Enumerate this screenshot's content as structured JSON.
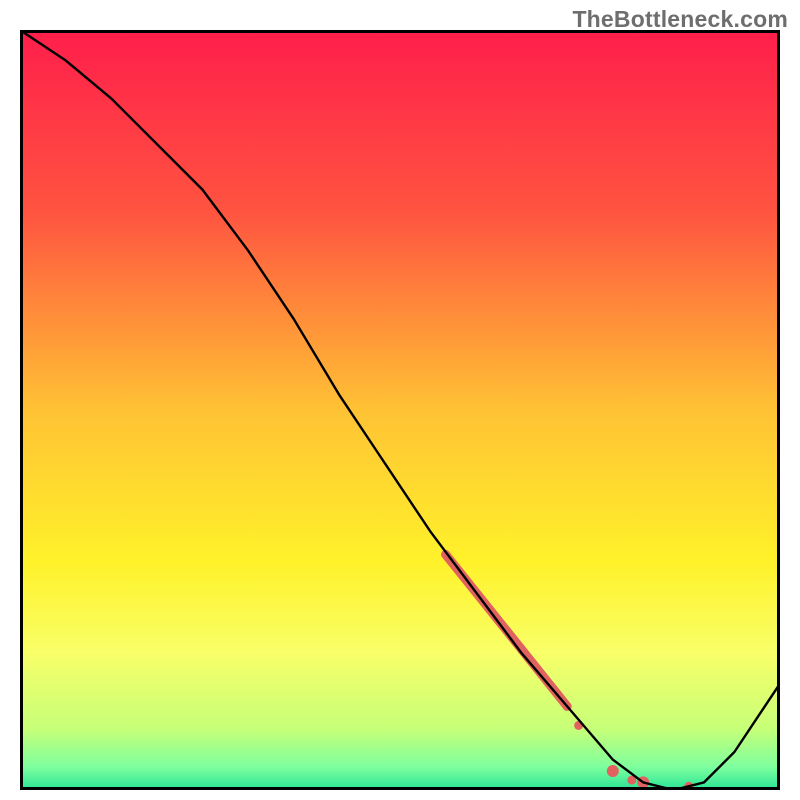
{
  "watermark": "TheBottleneck.com",
  "chart_data": {
    "type": "line",
    "title": "",
    "xlabel": "",
    "ylabel": "",
    "xlim": [
      0,
      100
    ],
    "ylim": [
      0,
      100
    ],
    "background_gradient": {
      "stops": [
        {
          "offset": 0.0,
          "color": "#ff1e4b"
        },
        {
          "offset": 0.24,
          "color": "#ff5440"
        },
        {
          "offset": 0.5,
          "color": "#ffc234"
        },
        {
          "offset": 0.7,
          "color": "#fff22a"
        },
        {
          "offset": 0.82,
          "color": "#f8ff68"
        },
        {
          "offset": 0.92,
          "color": "#c6ff78"
        },
        {
          "offset": 0.97,
          "color": "#7dff9e"
        },
        {
          "offset": 1.0,
          "color": "#28e396"
        }
      ]
    },
    "series": [
      {
        "name": "curve",
        "x": [
          0,
          6,
          12,
          18,
          24,
          30,
          36,
          42,
          48,
          54,
          60,
          66,
          72,
          78,
          82,
          86,
          90,
          94,
          100
        ],
        "y": [
          100,
          96,
          91,
          85,
          79,
          71,
          62,
          52,
          43,
          34,
          26,
          18,
          11,
          4,
          1,
          0,
          1,
          5,
          14
        ]
      }
    ],
    "highlight_segments": [
      {
        "name": "thick-segment",
        "x": [
          56,
          72
        ],
        "y": [
          31,
          11
        ],
        "width": 9,
        "color": "#e1625f"
      }
    ],
    "highlight_points": [
      {
        "x": 73.5,
        "y": 8.5,
        "r": 4.5,
        "color": "#e1625f"
      },
      {
        "x": 80.5,
        "y": 1.3,
        "r": 4.5,
        "color": "#e1625f"
      },
      {
        "x": 78.0,
        "y": 2.5,
        "r": 6.0,
        "color": "#e1625f"
      },
      {
        "x": 82.0,
        "y": 1.0,
        "r": 6.0,
        "color": "#e1625f"
      },
      {
        "x": 88.0,
        "y": 0.5,
        "r": 4.5,
        "color": "#e1625f"
      }
    ]
  }
}
